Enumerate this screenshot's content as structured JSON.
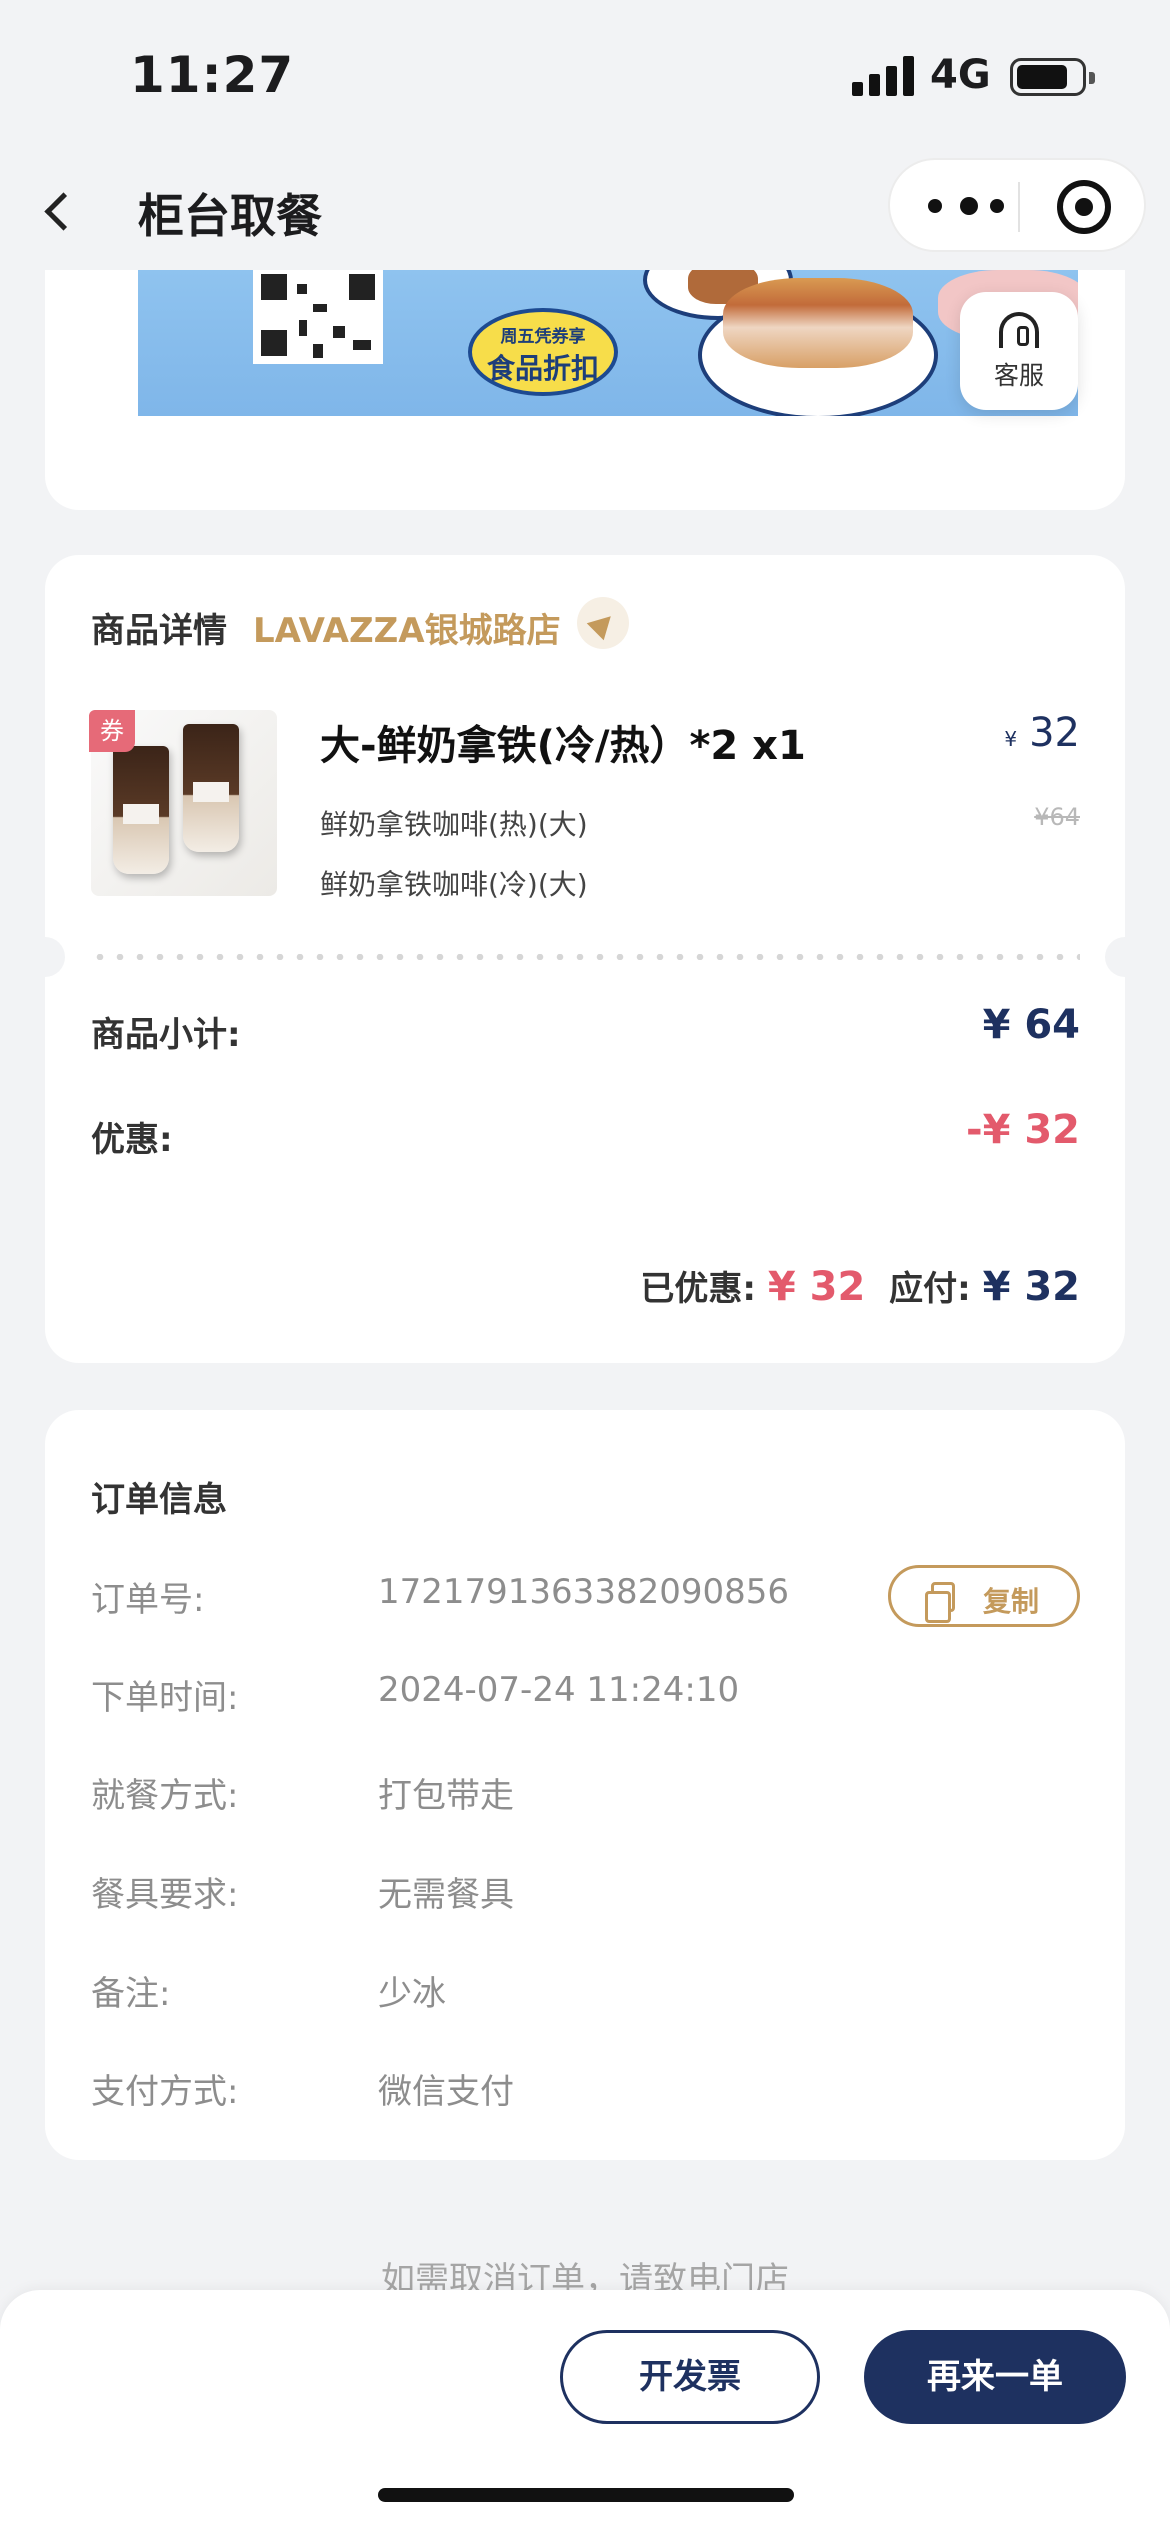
{
  "status_bar": {
    "time": "11:27",
    "network": "4G"
  },
  "nav": {
    "title": "柜台取餐"
  },
  "banner": {
    "badge_small": "周五凭券享",
    "badge_big": "食品折扣"
  },
  "service": {
    "label": "客服"
  },
  "product_section": {
    "title": "商品详情",
    "store": "LAVAZZA银城路店",
    "item": {
      "coupon_tag": "券",
      "name": "大-鲜奶拿铁(冷/热）*2 x1",
      "currency": "¥",
      "price": "32",
      "original_price": "¥64",
      "options": [
        "鲜奶拿铁咖啡(热)(大)",
        "鲜奶拿铁咖啡(冷)(大)"
      ]
    },
    "subtotal_label": "商品小计:",
    "subtotal_value": "¥ 64",
    "discount_label": "优惠:",
    "discount_value": "-¥ 32",
    "saved_label": "已优惠:",
    "saved_value": "¥ 32",
    "payable_label": "应付:",
    "payable_value": "¥ 32"
  },
  "order_info": {
    "title": "订单信息",
    "copy_label": "复制",
    "rows": [
      {
        "label": "订单号:",
        "value": "1721791363382090856"
      },
      {
        "label": "下单时间:",
        "value": "2024-07-24 11:24:10"
      },
      {
        "label": "就餐方式:",
        "value": "打包带走"
      },
      {
        "label": "餐具要求:",
        "value": "无需餐具"
      },
      {
        "label": "备注:",
        "value": "少冰"
      },
      {
        "label": "支付方式:",
        "value": "微信支付"
      }
    ]
  },
  "cancel_tip": "如需取消订单，请致电门店",
  "actions": {
    "invoice": "开发票",
    "reorder": "再来一单"
  },
  "colors": {
    "navy": "#1e3160",
    "gold": "#c49a5c",
    "red": "#e35a6c"
  }
}
